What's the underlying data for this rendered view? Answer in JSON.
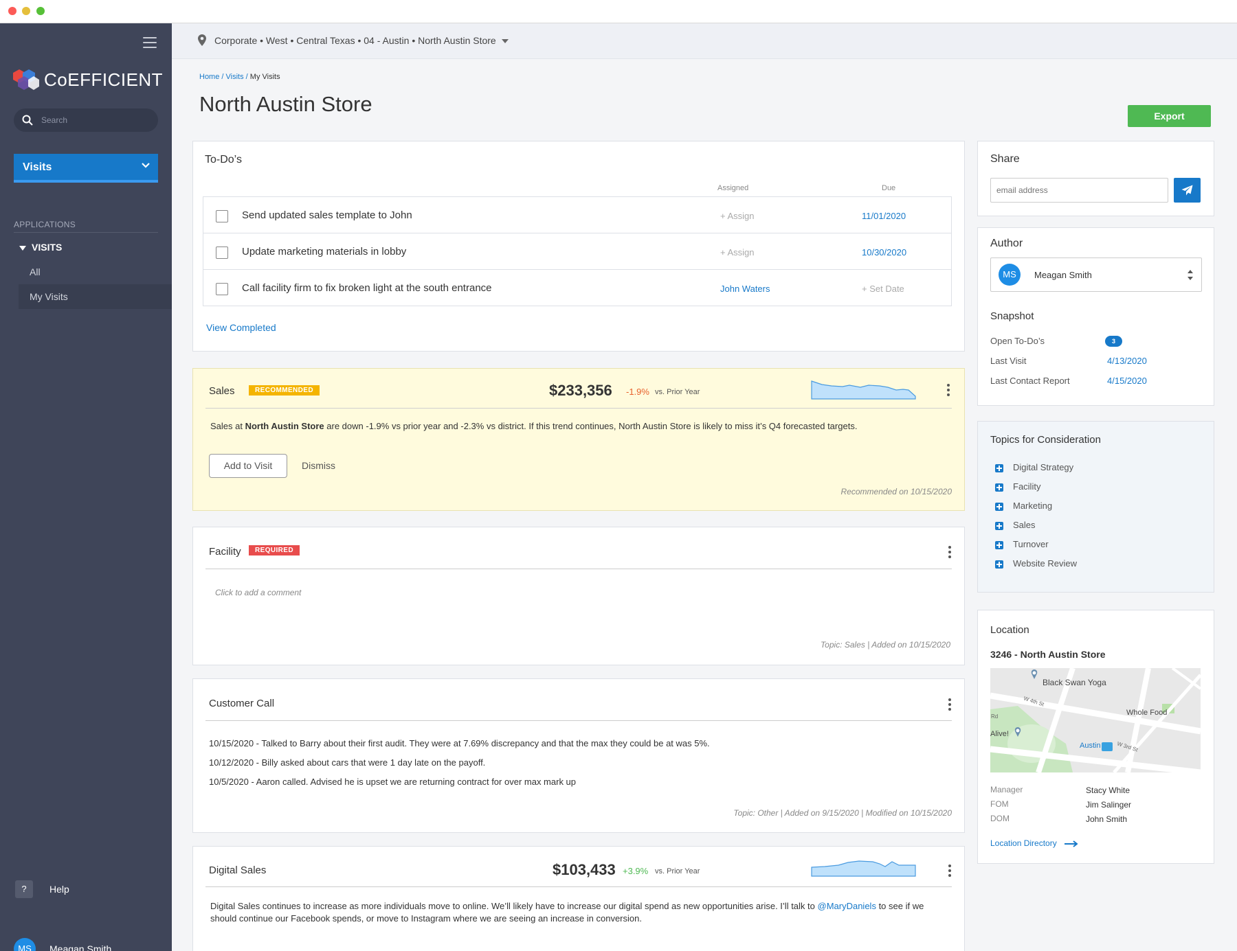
{
  "app": {
    "brand": "CoEFFICIENT"
  },
  "sidebar": {
    "search_placeholder": "Search",
    "visits_dropdown": "Visits",
    "applications_label": "APPLICATIONS",
    "section": "VISITS",
    "items": [
      {
        "label": "All"
      },
      {
        "label": "My Visits"
      }
    ],
    "help_label": "Help",
    "help_icon": "?",
    "user": {
      "initials": "MS",
      "name": "Meagan Smith"
    }
  },
  "topbar": {
    "location_path": "Corporate • West • Central Texas • 04 - Austin • North Austin Store"
  },
  "breadcrumb": {
    "home": "Home",
    "visits": "/ Visits",
    "sep": "/",
    "current": "My Visits"
  },
  "page": {
    "title": "North Austin Store",
    "export_label": "Export"
  },
  "todos": {
    "title": "To-Do’s",
    "assigned_header": "Assigned",
    "due_header": "Due",
    "items": [
      {
        "text": "Send updated sales template to John",
        "assigned": "+ Assign",
        "due": "11/01/2020"
      },
      {
        "text": "Update marketing materials in lobby",
        "assigned": "+ Assign",
        "due": "10/30/2020"
      },
      {
        "text": "Call facility firm to fix broken light at the south entrance",
        "assigned": "John Waters",
        "due": "+ Set Date"
      }
    ],
    "view_completed": "View Completed"
  },
  "sales": {
    "title": "Sales",
    "badge": "RECOMMENDED",
    "value": "$233,356",
    "change": "-1.9%",
    "compare": "vs. Prior Year",
    "desc_pre": "Sales at ",
    "desc_bold": "North Austin Store",
    "desc_post": " are down -1.9% vs prior year and -2.3% vs district.  If this trend continues, North Austin Store is likely to miss it’s Q4 forecasted targets.",
    "add_label": "Add to Visit",
    "dismiss_label": "Dismiss",
    "footer": "Recommended on 10/15/2020"
  },
  "facility": {
    "title": "Facility",
    "badge": "REQUIRED",
    "placeholder": "Click to add a comment",
    "footer": "Topic: Sales  |  Added on 10/15/2020"
  },
  "customer_call": {
    "title": "Customer Call",
    "notes": [
      "10/15/2020 - Talked to Barry about their first audit. They were at 7.69% discrepancy and that the max they could be at was 5%.",
      "10/12/2020 - Billy asked about cars that were 1 day late on the payoff.",
      "10/5/2020 - Aaron called. Advised he is upset we are returning contract for over max mark up"
    ],
    "footer": "Topic: Other  |  Added on 9/15/2020  |  Modified on 10/15/2020"
  },
  "digital_sales": {
    "title": "Digital Sales",
    "value": "$103,433",
    "change": "+3.9%",
    "compare": "vs. Prior Year",
    "desc_pre": "Digital Sales continues to increase as more individuals move to online. We’ll likely have to increase our digital spend as new opportunities arise.  I’ll talk to ",
    "mention": "@MaryDaniels",
    "desc_post": " to see if we should continue our Facebook spends, or move to Instagram where we are seeing an increase in conversion."
  },
  "share": {
    "title": "Share",
    "placeholder": "email address"
  },
  "author": {
    "title": "Author",
    "initials": "MS",
    "name": "Meagan Smith"
  },
  "snapshot": {
    "title": "Snapshot",
    "open_todos_label": "Open To-Do’s",
    "open_todos_count": "3",
    "last_visit_label": "Last Visit",
    "last_visit": "4/13/2020",
    "last_contact_label": "Last Contact Report",
    "last_contact": "4/15/2020"
  },
  "topics": {
    "title": "Topics for Consideration",
    "items": [
      "Digital Strategy",
      "Facility",
      "Marketing",
      "Sales",
      "Turnover",
      "Website Review"
    ]
  },
  "location": {
    "title": "Location",
    "store": "3246 - North Austin Store",
    "map": {
      "poi1": "Black Swan Yoga",
      "poi2": "Whole Food",
      "poi3": "Alive!",
      "poi4": "Austin",
      "street1": "W 4th St",
      "street2": "W 3rd St",
      "street3": "Rd"
    },
    "people": [
      {
        "role": "Manager",
        "name": "Stacy White"
      },
      {
        "role": "FOM",
        "name": "Jim Salinger"
      },
      {
        "role": "DOM",
        "name": "John Smith"
      }
    ],
    "directory_link": "Location Directory"
  },
  "colors": {
    "accent": "#1779c9",
    "sidebar": "#3f4559",
    "success": "#4fb953",
    "warning": "#f4b400",
    "danger": "#e84c4c",
    "recommended_bg": "#fffbdd",
    "topics_bg": "#f1f5f9"
  }
}
